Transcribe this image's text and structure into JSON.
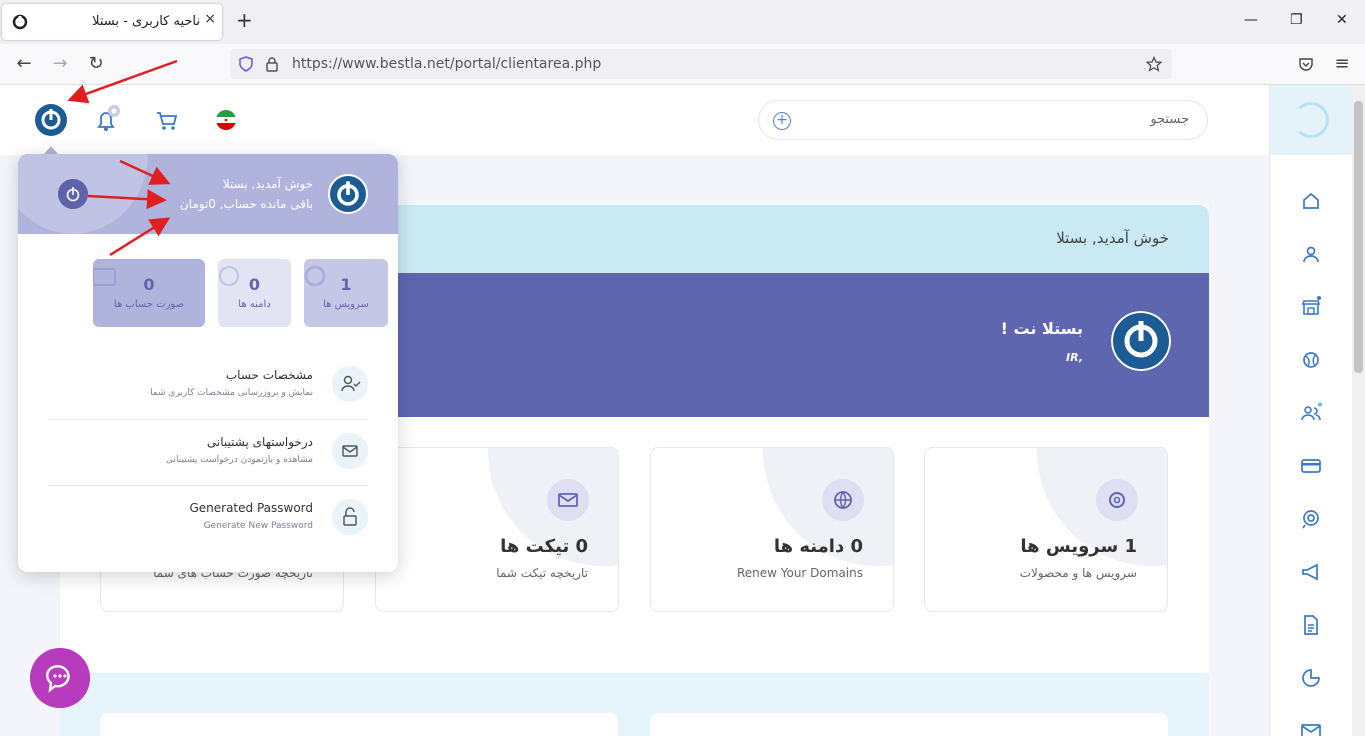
{
  "browser": {
    "tab_title": "ناحیه کاربری - بستلا",
    "tab_close": "×",
    "new_tab": "+",
    "url": "https://www.bestla.net/portal/clientarea.php",
    "win_min": "—",
    "win_max": "❐",
    "win_close": "✕"
  },
  "header": {
    "search_placeholder": "جستجو",
    "search_plus": "+"
  },
  "welcome_strip": {
    "text": "خوش آمدید, بستلا"
  },
  "banner": {
    "title": "بستلا نت !",
    "subtitle": "IR,"
  },
  "cards": [
    {
      "title": "1 سرویس ها",
      "subtitle": "سرویس ها و محصولات",
      "icon": "gear-icon"
    },
    {
      "title": "0 دامنه ها",
      "subtitle": "Renew Your Domains",
      "icon": "globe-icon"
    },
    {
      "title": "0 تیکت ها",
      "subtitle": "تاریخچه تیکت شما",
      "icon": "mail-icon"
    },
    {
      "title": "",
      "subtitle": "تاریخچه صورت حساب های شما",
      "icon": "invoice-icon"
    }
  ],
  "dropdown": {
    "welcome": "خوش آمدید, بستلا",
    "balance": "باقی مانده حساب, 0تومان",
    "tiles": [
      {
        "count": "1",
        "label": "سرویس ها",
        "color": "#c5c7e6"
      },
      {
        "count": "0",
        "label": "دامنه ها",
        "color": "#e2e3f3"
      },
      {
        "count": "0",
        "label": "صورت حساب ها",
        "color": "#b0b3db"
      }
    ],
    "items": [
      {
        "title": "مشخصات حساب",
        "subtitle": "نمایش و بروزرسانی مشخصات کاربری شما"
      },
      {
        "title": "درخواستهای پشتیبانی",
        "subtitle": "مشاهده و بازنمودن درخواست پشتیبانی"
      },
      {
        "title": "Generated Password",
        "subtitle": "Generate New Password"
      }
    ]
  },
  "colors": {
    "accent": "#5f66b0",
    "brand_blue": "#1d5b95",
    "chat": "#b63bbd",
    "annotation_arrow": "#e02020"
  }
}
